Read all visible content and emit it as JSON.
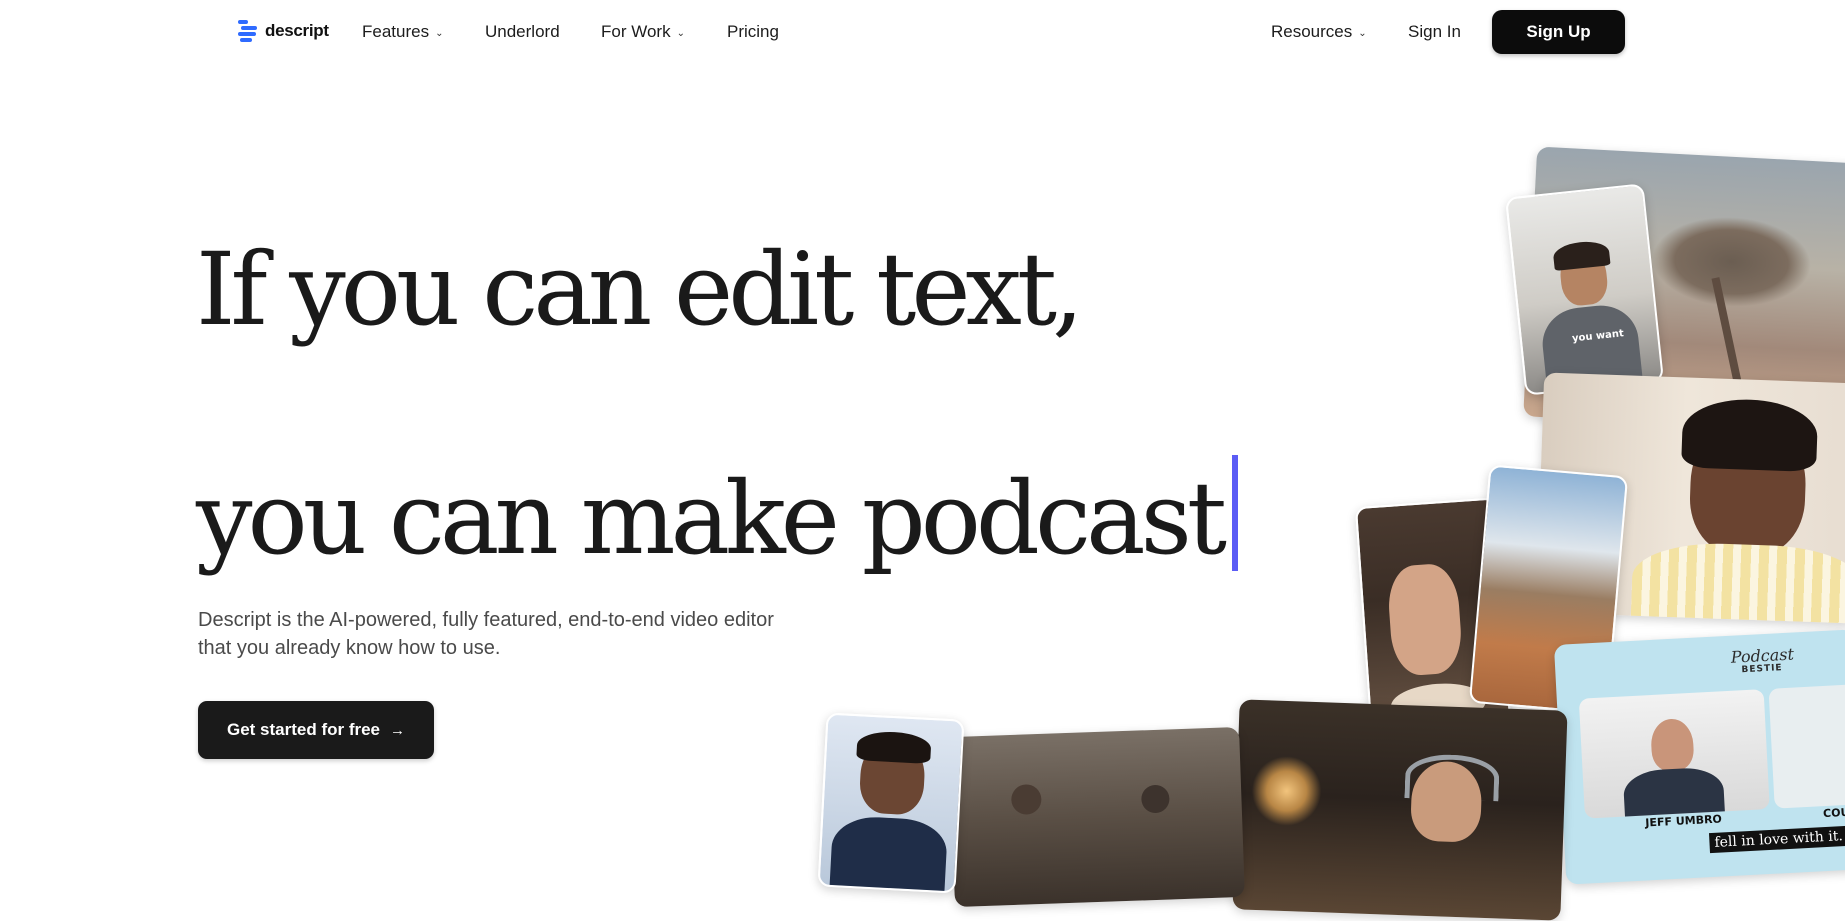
{
  "nav": {
    "logo_text": "descript",
    "items": [
      {
        "label": "Features",
        "dropdown": true
      },
      {
        "label": "Underlord",
        "dropdown": false
      },
      {
        "label": "For Work",
        "dropdown": true
      },
      {
        "label": "Pricing",
        "dropdown": false
      }
    ],
    "resources_label": "Resources",
    "signin_label": "Sign In",
    "signup_label": "Sign Up"
  },
  "hero": {
    "headline_line1": "If you can edit text,",
    "headline_line2": "you can make podcast",
    "subtitle_line1": "Descript is the AI-powered, fully featured, end-to-end video editor",
    "subtitle_line2": "that you already know how to use.",
    "cta_label": "Get started for free",
    "cta_arrow": "→"
  },
  "media": {
    "tile_caption_1": "you want",
    "podcast_logo": "Podcast",
    "podcast_logo_sub": "BESTIE",
    "guest_name_1": "JEFF UMBRO",
    "guest_name_2": "COU",
    "subtitle_text": "fell in love with it."
  },
  "colors": {
    "brand_blue": "#2f6bff",
    "caret": "#5b5cf5",
    "button_dark": "#0c0c0c"
  },
  "icons": {
    "logo": "descript-logo-icon",
    "chevron": "chevron-down-icon",
    "arrow": "arrow-right-icon"
  }
}
